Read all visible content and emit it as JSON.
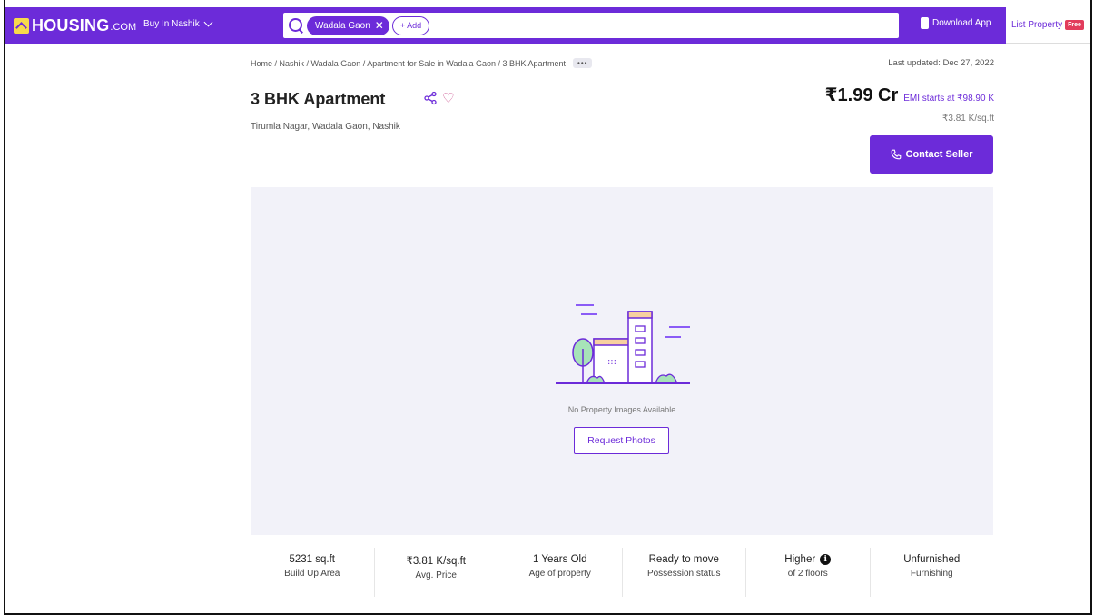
{
  "header": {
    "logo_text": "HOUSING",
    "logo_suffix": ".COM",
    "city_select": "Buy In Nashik",
    "search_chip": "Wadala Gaon",
    "add_chip": "+ Add",
    "download_app": "Download App",
    "list_property": "List Property",
    "free_badge": "Free"
  },
  "breadcrumb": {
    "path": "Home / Nashik / Wadala Gaon / Apartment for Sale in Wadala Gaon / 3 BHK Apartment",
    "more": "•••"
  },
  "listing": {
    "title": "3 BHK Apartment",
    "location": "Tirumla Nagar, Wadala Gaon, Nashik",
    "last_updated": "Last updated: Dec 27, 2022",
    "price": "₹1.99 Cr",
    "emi": "EMI starts at ₹98.90 K",
    "price_per_sqft": "₹3.81 K/sq.ft",
    "contact_button": "Contact Seller"
  },
  "gallery": {
    "empty_message": "No Property Images Available",
    "request_button": "Request Photos"
  },
  "stats": [
    {
      "value": "5231 sq.ft",
      "label": "Build Up Area"
    },
    {
      "value": "₹3.81 K/sq.ft",
      "label": "Avg. Price"
    },
    {
      "value": "1 Years Old",
      "label": "Age of property"
    },
    {
      "value": "Ready to move",
      "label": "Possession status"
    },
    {
      "value": "Higher",
      "label": "of 2 floors"
    },
    {
      "value": "Unfurnished",
      "label": "Furnishing"
    }
  ],
  "colors": {
    "brand": "#6c2bd9",
    "logo_accent": "#f7d94c",
    "free_badge": "#e23c5c",
    "gallery_bg": "#f2f2f9"
  }
}
